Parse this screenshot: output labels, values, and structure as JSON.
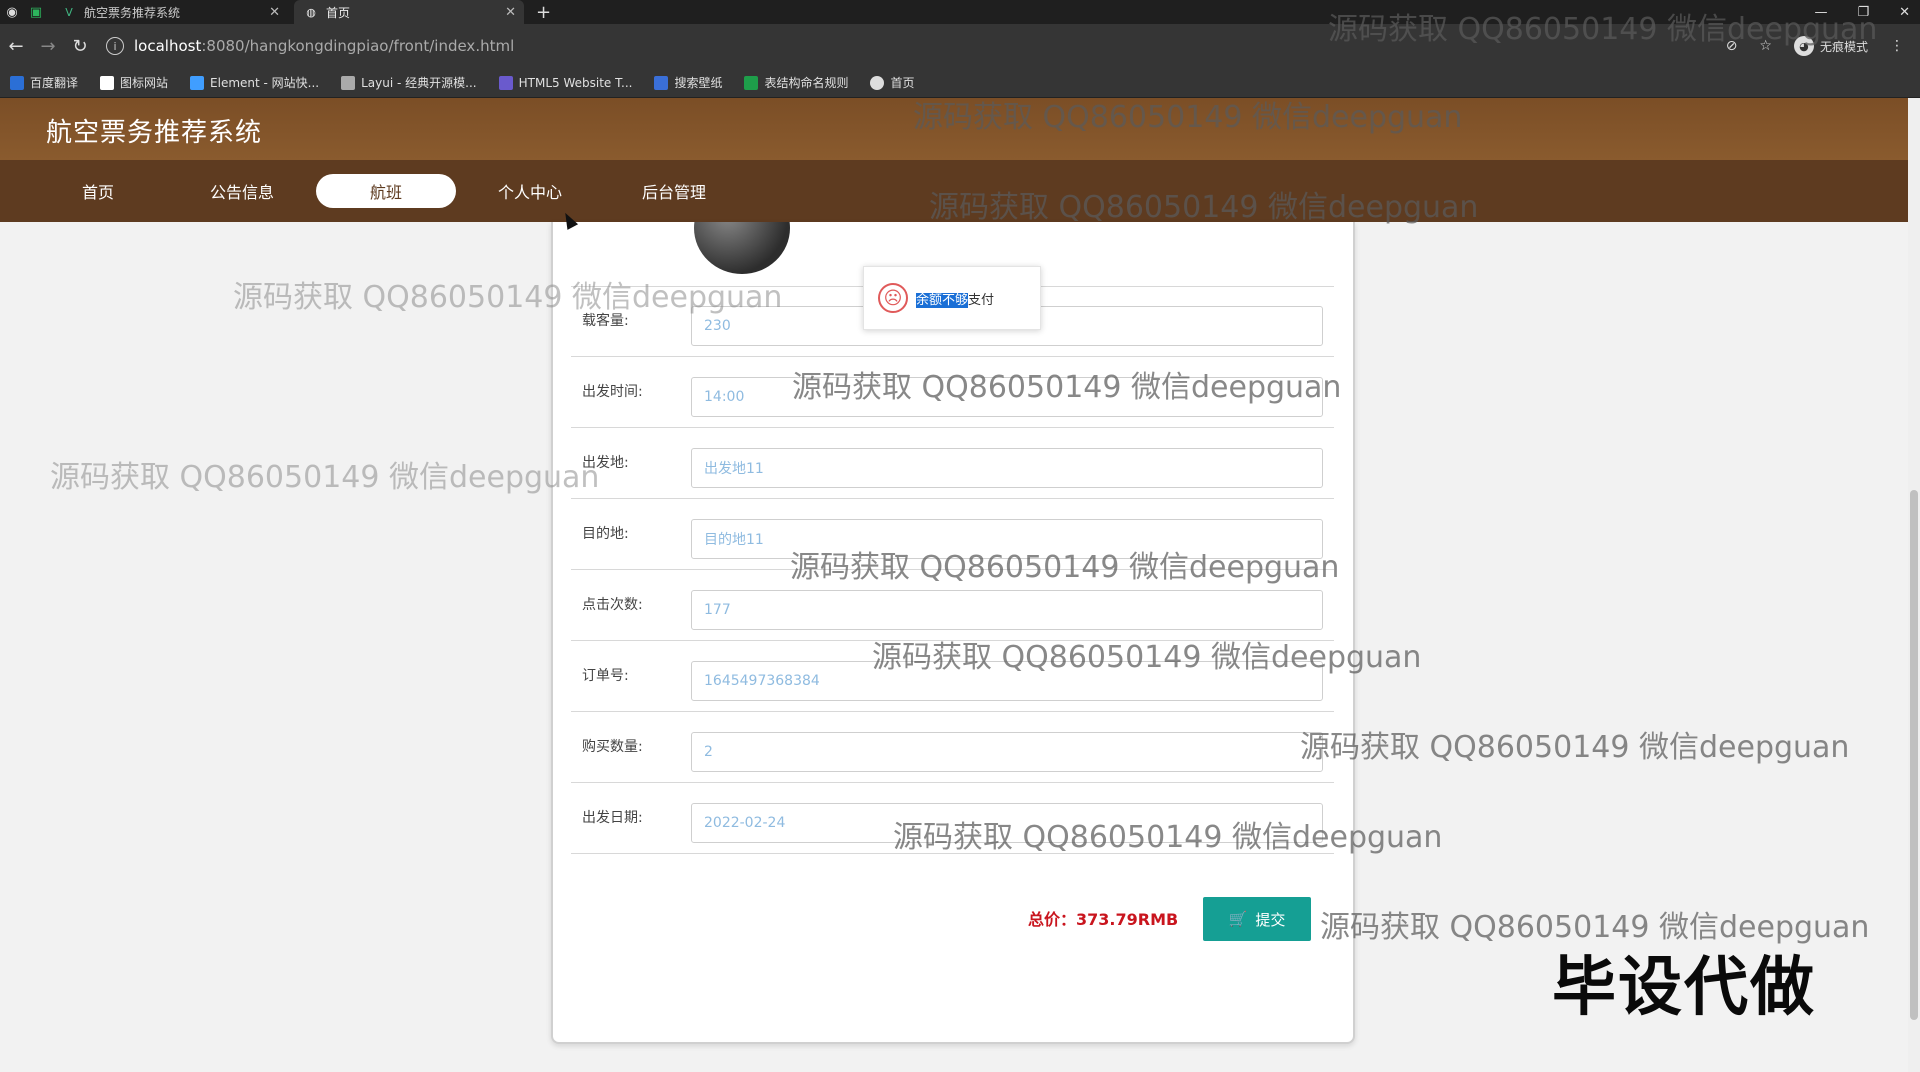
{
  "browser": {
    "tabs": [
      {
        "title": "航空票务推荐系统",
        "active": false
      },
      {
        "title": "首页",
        "active": true
      }
    ],
    "new_tab": "+",
    "url_host": "localhost",
    "url_path": ":8080/hangkongdingpiao/front/index.html",
    "incognito_label": "无痕模式",
    "bookmarks": [
      "百度翻译",
      "图标网站",
      "Element - 网站快...",
      "Layui - 经典开源模...",
      "HTML5 Website T...",
      "搜索壁纸",
      "表结构命名规则",
      "首页"
    ]
  },
  "app": {
    "title": "航空票务推荐系统",
    "nav": [
      "首页",
      "公告信息",
      "航班",
      "个人中心",
      "后台管理"
    ],
    "active_nav": "航班"
  },
  "form": {
    "fields": [
      {
        "label": "载客量:",
        "value": "230"
      },
      {
        "label": "出发时间:",
        "value": "14:00"
      },
      {
        "label": "出发地:",
        "value": "出发地11"
      },
      {
        "label": "目的地:",
        "value": "目的地11"
      },
      {
        "label": "点击次数:",
        "value": "177"
      },
      {
        "label": "订单号:",
        "value": "1645497368384"
      },
      {
        "label": "购买数量:",
        "value": "2"
      },
      {
        "label": "出发日期:",
        "value": "2022-02-24"
      }
    ],
    "total": "总价：373.79RMB",
    "submit_label": "提交"
  },
  "toast": {
    "highlighted": "余额不够",
    "rest": "支付"
  },
  "watermark": "源码获取 QQ86050149 微信deepguan",
  "stamp": "毕设代做",
  "colors": {
    "header": "#8a5b2e",
    "nav": "#5e3b20",
    "submit": "#159f94",
    "total": "#c9151e"
  }
}
